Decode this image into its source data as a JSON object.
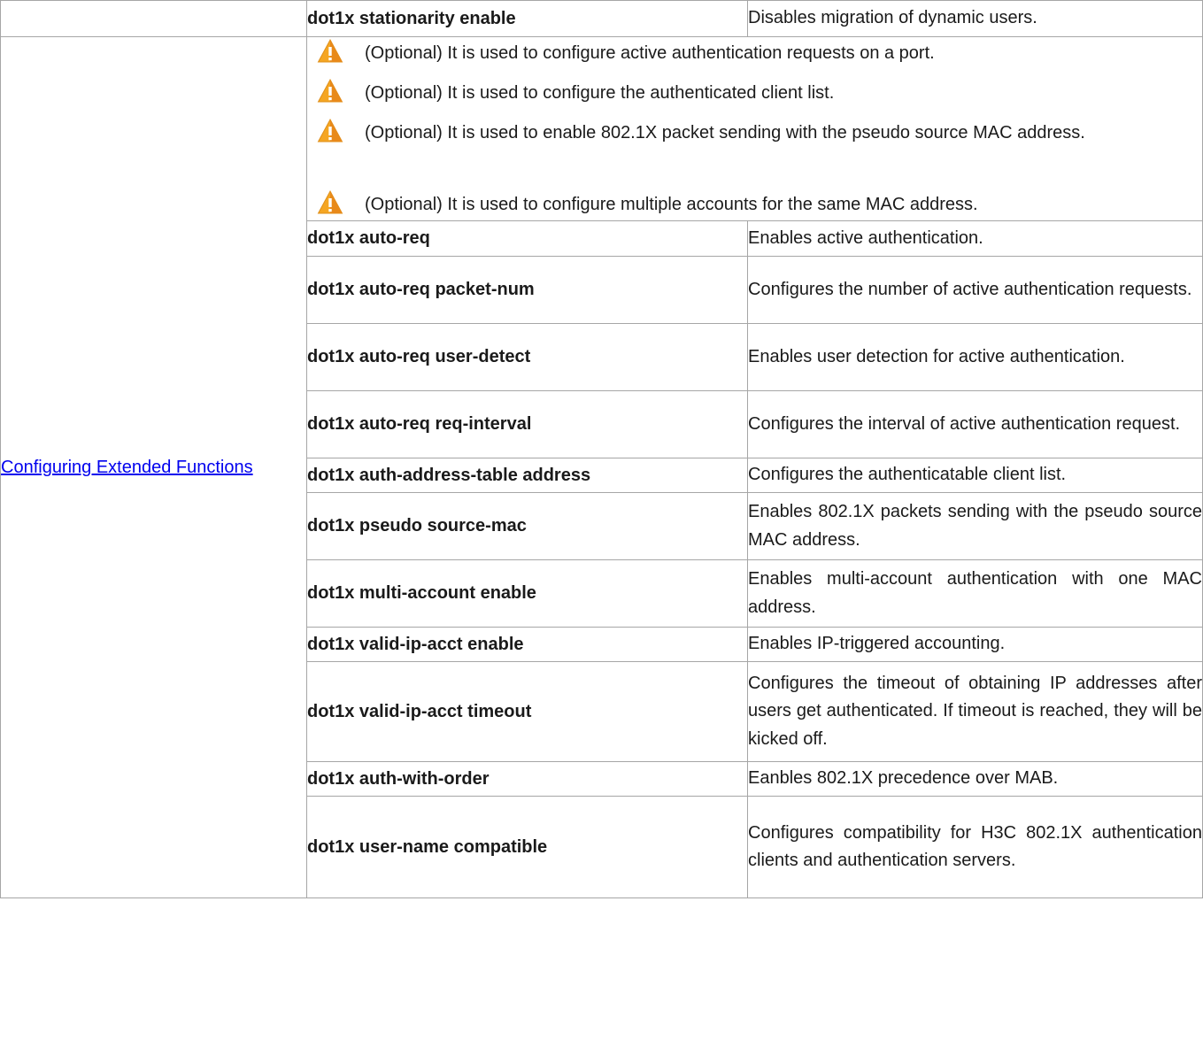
{
  "rows_top": {
    "command": "dot1x stationarity enable",
    "description": "Disables migration of dynamic users."
  },
  "section": {
    "task_link": "Configuring Extended Functions"
  },
  "notes": [
    {
      "icon": "warning-icon",
      "text": "(Optional) It is used to configure active authentication requests on a port."
    },
    {
      "icon": "warning-icon",
      "text": "(Optional) It is used to configure the authenticated client list."
    },
    {
      "icon": "warning-icon",
      "text": "(Optional) It is used to enable 802.1X packet sending with the pseudo source MAC address."
    },
    {
      "icon": "warning-icon",
      "text": "(Optional) It is used to configure multiple accounts for the same MAC address."
    }
  ],
  "commands": [
    {
      "command": "dot1x auto-req",
      "description": "Enables active authentication."
    },
    {
      "command": "dot1x auto-req packet-num",
      "description": "Configures the number of active authentication requests."
    },
    {
      "command": "dot1x auto-req user-detect",
      "description": "Enables user detection for active authentication."
    },
    {
      "command": "dot1x auto-req req-interval",
      "description": "Configures the interval of active authentication request."
    },
    {
      "command": "dot1x auth-address-table address",
      "description": "Configures the authenticatable client list."
    },
    {
      "command": "dot1x pseudo source-mac",
      "description": "Enables 802.1X packets sending with the pseudo source MAC address."
    },
    {
      "command": "dot1x multi-account enable",
      "description": "Enables multi-account authentication with one MAC address."
    },
    {
      "command": "dot1x valid-ip-acct enable",
      "description": "Enables IP-triggered accounting."
    },
    {
      "command": "dot1x valid-ip-acct timeout",
      "description": "Configures the timeout of obtaining IP addresses after users get authenticated. If timeout is reached, they will be kicked off."
    },
    {
      "command": "dot1x auth-with-order",
      "description": "Eanbles 802.1X precedence over MAB."
    },
    {
      "command": "dot1x user-name compatible",
      "description": "Configures compatibility for H3C 802.1X authentication clients and authentication servers."
    }
  ],
  "colors": {
    "link": "#0000ee",
    "warning_fill": "#f5a623",
    "border": "#a6a6a6"
  }
}
